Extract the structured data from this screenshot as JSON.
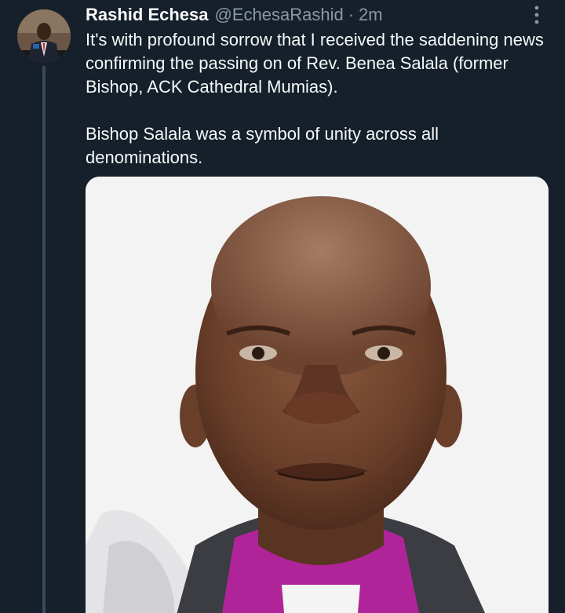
{
  "tweet": {
    "author": {
      "display_name": "Rashid Echesa",
      "handle": "@EchesaRashid",
      "separator": "·",
      "time": "2m"
    },
    "text": {
      "paragraph_1": "It's with profound sorrow that I received the saddening news confirming the passing on of Rev. Benea Salala (former Bishop, ACK Cathedral Mumias).",
      "paragraph_2": "Bishop Salala was a symbol of unity across all denominations."
    },
    "icons": {
      "more": "more-options-icon"
    }
  }
}
